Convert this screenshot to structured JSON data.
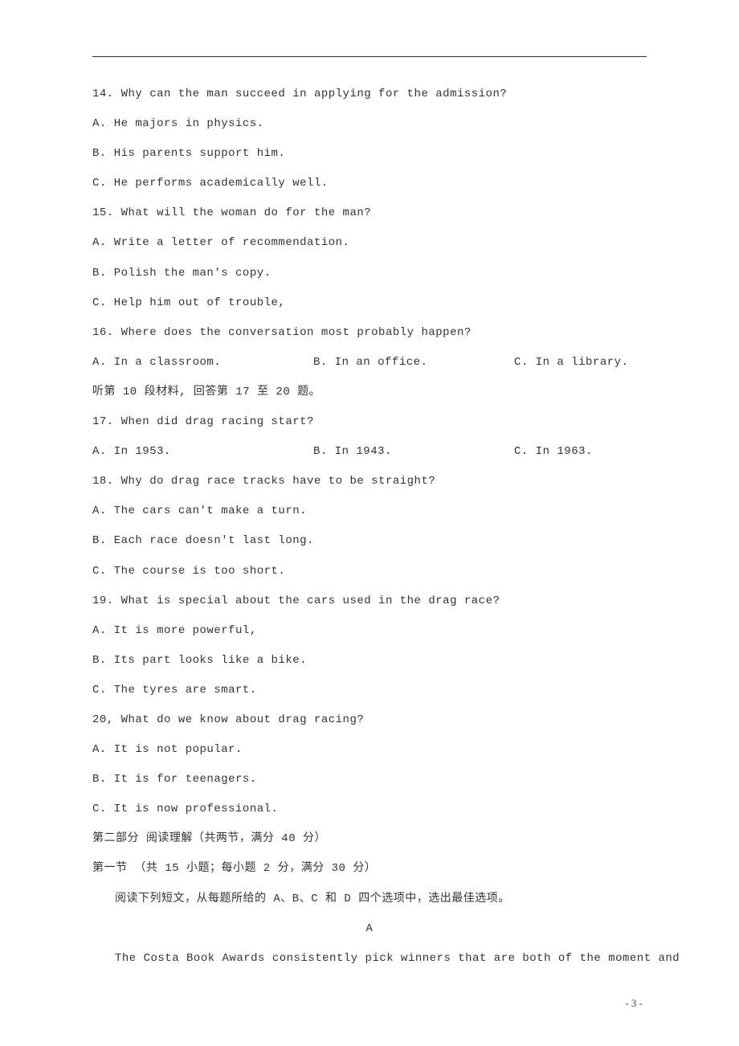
{
  "q14": {
    "stem": "14. Why can the man succeed in applying for the admission?",
    "a": "A. He majors in physics.",
    "b": "B. His parents support him.",
    "c": "C. He performs academically well."
  },
  "q15": {
    "stem": "15. What will the woman do for the man?",
    "a": "A. Write a letter of recommendation.",
    "b": "B. Polish the man's copy.",
    "c": "C. Help him out of trouble,"
  },
  "q16": {
    "stem": "16. Where does the conversation most probably happen?",
    "a": "A. In a classroom.",
    "b": "B. In an office.",
    "c": "C. In a library."
  },
  "directions10": "听第 10 段材料, 回答第 17 至 20 题。",
  "q17": {
    "stem": "17. When did drag racing start?",
    "a": "A. In 1953.",
    "b": "B. In 1943.",
    "c": "C. In 1963."
  },
  "q18": {
    "stem": "18. Why do drag race tracks have to be straight?",
    "a": "A. The cars can't make a turn.",
    "b": "B. Each race doesn't last long.",
    "c": "C. The course is too short."
  },
  "q19": {
    "stem": "19. What is special about the cars used in the drag race?",
    "a": "A. It is more powerful,",
    "b": "B. Its part looks like a bike.",
    "c": "C. The tyres are smart."
  },
  "q20": {
    "stem": "20, What do we know about drag racing?",
    "a": "A. It is not popular.",
    "b": "B. It is for teenagers.",
    "c": "C. It is now professional."
  },
  "part2_heading": "第二部分 阅读理解（共两节，满分 40 分）",
  "part2_sub": "第一节 （共 15 小题；每小题 2 分，满分 30 分）",
  "reading_instruction": "阅读下列短文，从每题所给的 A、B、C 和 D 四个选项中，选出最佳选项。",
  "passage_label": "A",
  "passage_line1": "The Costa Book Awards consistently pick winners that are both of the moment and",
  "page_number": "- 3 -"
}
